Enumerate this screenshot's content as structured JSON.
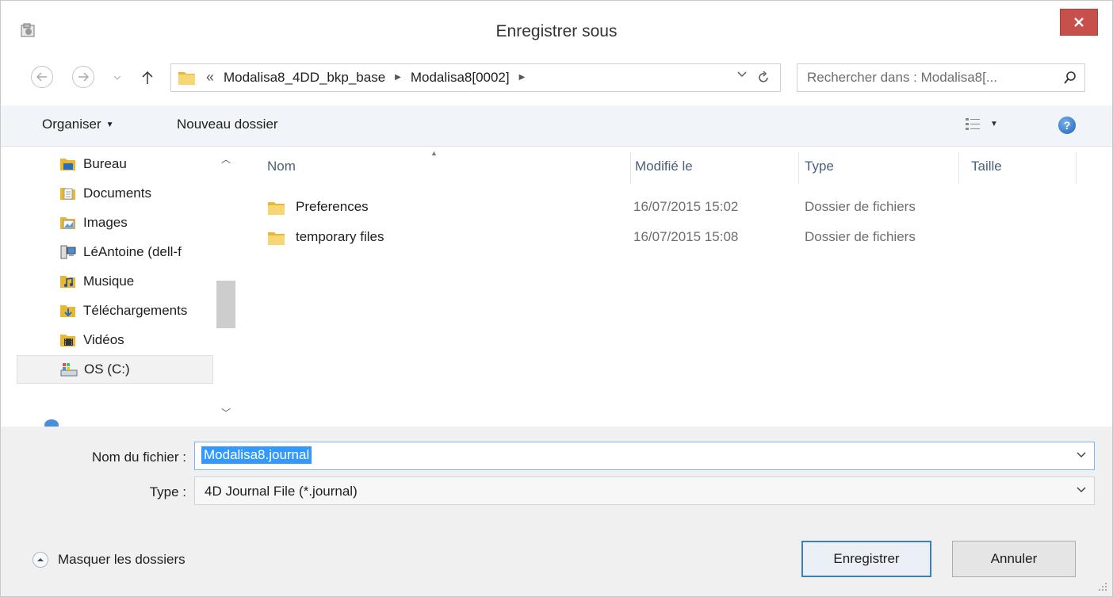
{
  "window": {
    "title": "Enregistrer sous"
  },
  "address": {
    "crumbs": [
      "Modalisa8_4DD_bkp_base",
      "Modalisa8[0002]"
    ],
    "overflow_glyph": "«"
  },
  "search": {
    "placeholder": "Rechercher dans : Modalisa8[..."
  },
  "toolbar": {
    "organize_label": "Organiser",
    "new_folder_label": "Nouveau dossier"
  },
  "sidebar": {
    "items": [
      {
        "label": "Bureau",
        "icon": "desktop-folder-icon"
      },
      {
        "label": "Documents",
        "icon": "documents-icon"
      },
      {
        "label": "Images",
        "icon": "pictures-icon"
      },
      {
        "label": "LéAntoine (dell-f",
        "icon": "network-computer-icon"
      },
      {
        "label": "Musique",
        "icon": "music-folder-icon"
      },
      {
        "label": "Téléchargements",
        "icon": "downloads-folder-icon"
      },
      {
        "label": "Vidéos",
        "icon": "videos-folder-icon"
      },
      {
        "label": "OS (C:)",
        "icon": "drive-icon",
        "selected": true
      }
    ]
  },
  "columns": {
    "name": "Nom",
    "modified": "Modifié le",
    "type": "Type",
    "size": "Taille"
  },
  "files": [
    {
      "name": "Preferences",
      "modified": "16/07/2015 15:02",
      "type": "Dossier de fichiers"
    },
    {
      "name": "temporary files",
      "modified": "16/07/2015 15:08",
      "type": "Dossier de fichiers"
    }
  ],
  "form": {
    "filename_label": "Nom du fichier :",
    "filename_value": "Modalisa8.journal",
    "type_label": "Type :",
    "type_value": "4D Journal File (*.journal)"
  },
  "footer": {
    "hide_folders_label": "Masquer les dossiers",
    "save_label": "Enregistrer",
    "cancel_label": "Annuler"
  },
  "colors": {
    "close_button": "#c7504c",
    "toolbar_bg": "#f1f5fa",
    "selection": "#3399ff",
    "column_header": "#4c607a"
  }
}
